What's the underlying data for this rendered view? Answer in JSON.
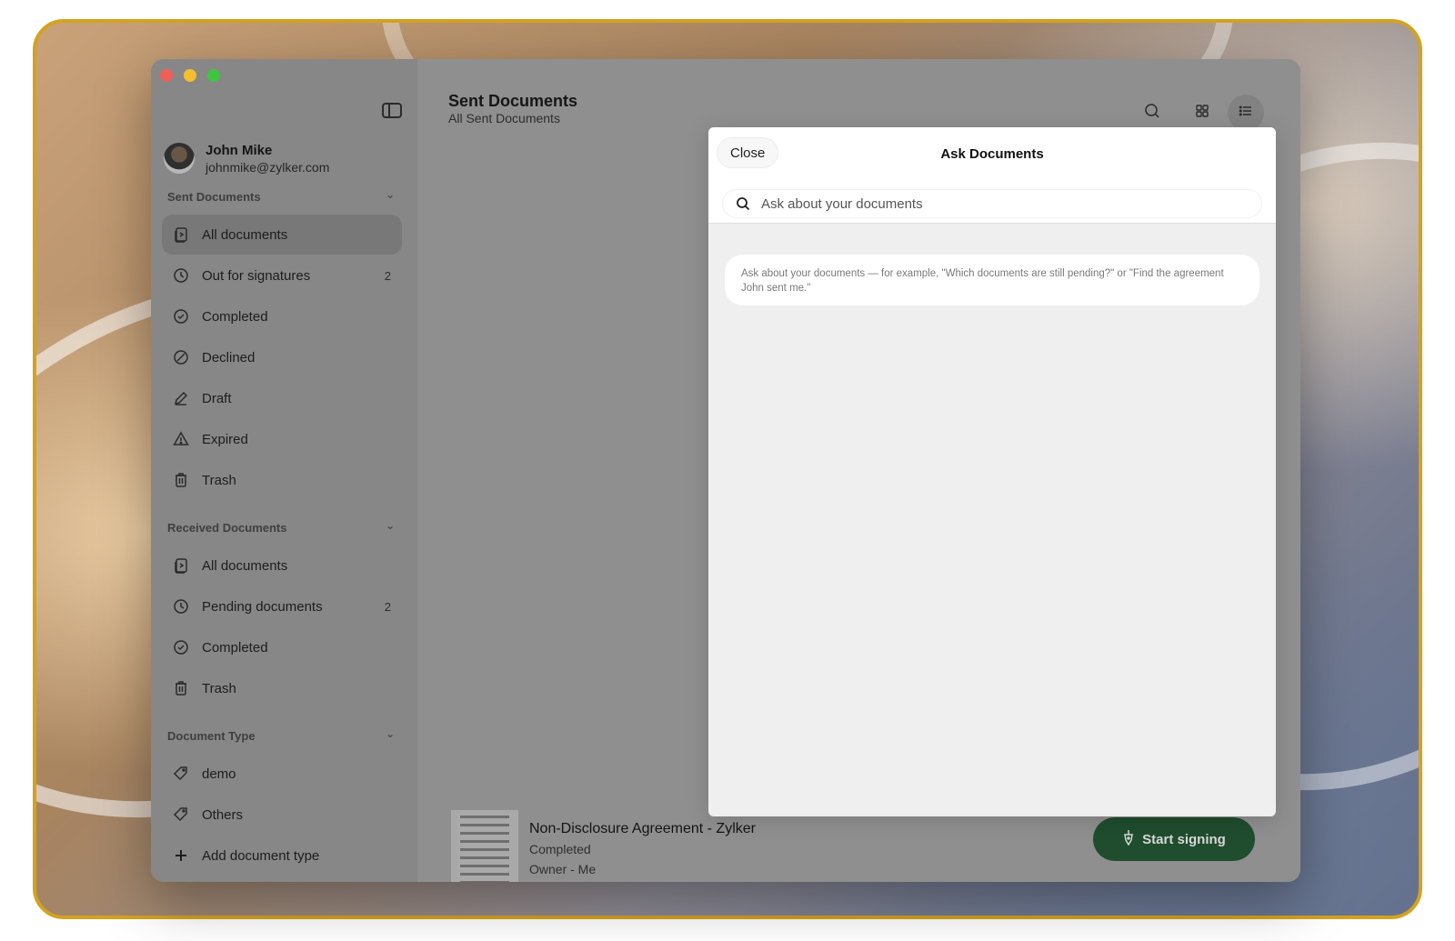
{
  "app": {
    "sidebar": {
      "user": {
        "name": "John Mike",
        "email": "johnmike@zylker.com"
      },
      "sections": [
        {
          "title": "Sent Documents",
          "items": [
            {
              "label": "All documents",
              "icon": "documents-icon",
              "active": true
            },
            {
              "label": "Out for signatures",
              "icon": "clock-icon",
              "count": "2"
            },
            {
              "label": "Completed",
              "icon": "check-circle-icon"
            },
            {
              "label": "Declined",
              "icon": "declined-icon"
            },
            {
              "label": "Draft",
              "icon": "pencil-icon"
            },
            {
              "label": "Expired",
              "icon": "warning-icon"
            },
            {
              "label": "Trash",
              "icon": "trash-icon"
            }
          ]
        },
        {
          "title": "Received Documents",
          "items": [
            {
              "label": "All documents",
              "icon": "documents-icon"
            },
            {
              "label": "Pending documents",
              "icon": "clock-icon",
              "count": "2"
            },
            {
              "label": "Completed",
              "icon": "check-circle-icon"
            },
            {
              "label": "Trash",
              "icon": "trash-icon"
            }
          ]
        },
        {
          "title": "Document Type",
          "items": [
            {
              "label": "demo",
              "icon": "tag-icon"
            },
            {
              "label": "Others",
              "icon": "tag-icon"
            },
            {
              "label": "Add document type",
              "icon": "plus-icon"
            }
          ]
        }
      ]
    },
    "main": {
      "title": "Sent Documents",
      "subtitle": "All Sent Documents",
      "document": {
        "title": "Non-Disclosure Agreement - Zylker",
        "status": "Completed",
        "owner": "Owner - Me"
      },
      "start_signing_label": "Start signing"
    },
    "modal": {
      "close_label": "Close",
      "title": "Ask Documents",
      "search_placeholder": "Ask about your documents",
      "hint": "Ask about your documents — for example, \"Which documents are still pending?\" or \"Find the agreement John sent me.\""
    }
  },
  "colors": {
    "frame_border": "#d4a21f",
    "start_button": "#1f4d2e",
    "traffic_red": "#ee5f57",
    "traffic_yellow": "#f5be2f",
    "traffic_green": "#3fc640"
  }
}
